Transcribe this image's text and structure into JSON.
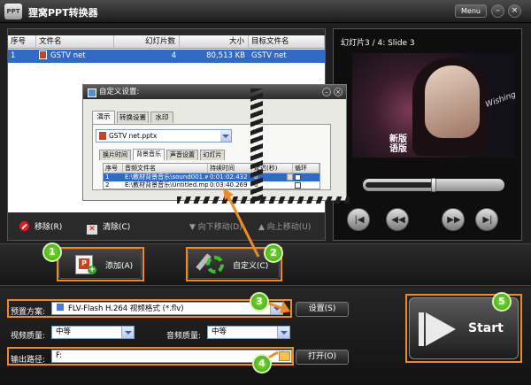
{
  "app": {
    "logo_text": "PPT",
    "title": "狸窝PPT转换器",
    "menu_label": "Menu",
    "minimize": "–",
    "close": "×"
  },
  "file_list": {
    "headers": [
      "序号",
      "文件名",
      "幻灯片数",
      "大小",
      "目标文件名"
    ],
    "rows": [
      {
        "index": "1",
        "name": "GSTV net",
        "slides": "4",
        "size": "80,513 KB",
        "target": "GSTV net"
      }
    ]
  },
  "toolbar": {
    "remove": "移除(R)",
    "clear": "清除(C)",
    "move_down": "向下移动(D)",
    "move_up": "向上移动(U)"
  },
  "preview": {
    "slide_label": "幻灯片3 / 4: Slide 3",
    "caption": "新版 语版",
    "signature": "Wishing",
    "progress": 0.5,
    "controls": [
      "prev-track",
      "rewind",
      "fast-forward",
      "next-track"
    ]
  },
  "actions": {
    "add": "添加(A)",
    "custom": "自定义(C)"
  },
  "badges": [
    "1",
    "2",
    "3",
    "4",
    "5"
  ],
  "settings": {
    "preset_label": "预置方案:",
    "preset_value": "FLV-Flash H.264 视频格式 (*.flv)",
    "settings_btn": "设置(S)",
    "video_quality_label": "视频质量:",
    "video_quality_value": "中等",
    "audio_quality_label": "音频质量:",
    "audio_quality_value": "中等",
    "output_label": "输出路径:",
    "output_value": "F:",
    "open_btn": "打开(O)",
    "start": "Start"
  },
  "dialog": {
    "title": "自定义设置:",
    "tabs": [
      "演示",
      "转换设置",
      "水印"
    ],
    "file_value": "GSTV net.pptx",
    "subtabs": [
      "换片时间",
      "背景音乐",
      "声音设置",
      "幻灯片"
    ],
    "music_headers": [
      "序号",
      "音频文件名",
      "持续时间",
      "延迟(秒)",
      "循环"
    ],
    "music_rows": [
      {
        "index": "1",
        "file": "E:\\教材背景音乐\\sound001.wav",
        "duration": "0:01:02.432",
        "delay": "0"
      },
      {
        "index": "2",
        "file": "E:\\教材背景音乐\\Untitled.mp3",
        "duration": "0:03:40.269",
        "delay": "0"
      }
    ]
  },
  "colors": {
    "highlight": "#f08a22",
    "selection": "#316ac5",
    "badge": "#5cc81e"
  }
}
